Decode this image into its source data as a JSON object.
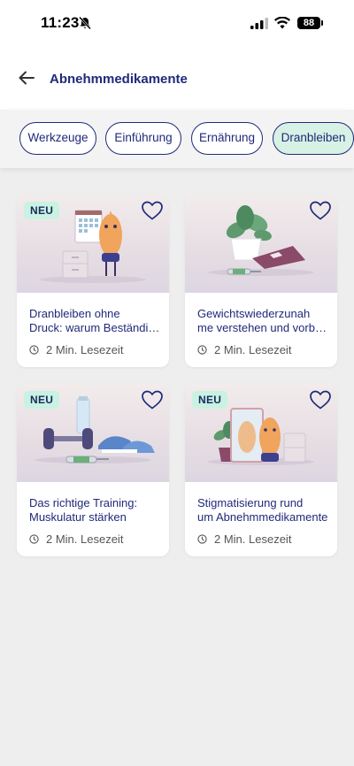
{
  "status": {
    "time": "11:23",
    "battery": "88"
  },
  "header": {
    "title": "Abnehmmedikamente",
    "back_icon": "arrow-left-icon"
  },
  "chips": [
    {
      "label": "Werkzeuge",
      "active": false
    },
    {
      "label": "Einführung",
      "active": false
    },
    {
      "label": "Ernährung",
      "active": false
    },
    {
      "label": "Dranbleiben",
      "active": true
    }
  ],
  "cards": [
    {
      "badge": "NEU",
      "title_line1": "Dranbleiben ohne",
      "title_line2": "Druck: warum Beständigkeit",
      "meta": "2 Min. Lesezeit"
    },
    {
      "badge": "",
      "title_line1": "Gewichtswiederzunah",
      "title_line2": "me verstehen und vorbeugen",
      "meta": "2 Min. Lesezeit"
    },
    {
      "badge": "NEU",
      "title_line1": "Das richtige Training:",
      "title_line2": "Muskulatur stärken",
      "meta": "2 Min. Lesezeit"
    },
    {
      "badge": "NEU",
      "title_line1": "Stigmatisierung rund",
      "title_line2": "um Abnehmmedikamente",
      "meta": "2 Min. Lesezeit"
    }
  ],
  "colors": {
    "primary": "#1f2a7a",
    "active_chip": "#d7f1e4",
    "badge": "#c9f2e2",
    "background": "#eeeeee"
  }
}
